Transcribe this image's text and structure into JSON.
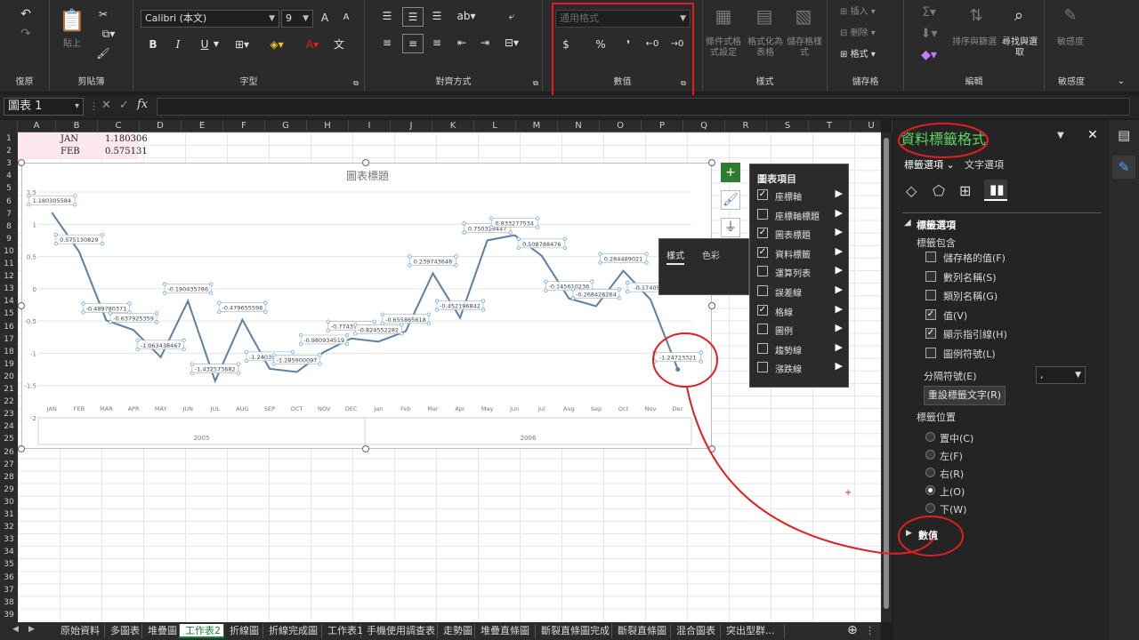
{
  "ribbon": {
    "clipboard": {
      "group_label": "剪貼簿",
      "paste": "貼上"
    },
    "undo": {
      "group_label": "復原"
    },
    "font": {
      "group_label": "字型",
      "name": "Calibri (本文)",
      "size": "9",
      "bold": "B",
      "italic": "I",
      "underline": "U",
      "grow": "A",
      "shrink": "A"
    },
    "alignment": {
      "group_label": "對齊方式"
    },
    "number": {
      "group_label": "數值",
      "format_placeholder": "通用格式",
      "currency": "$",
      "percent": "%",
      "comma": "❜",
      "inc_decimal": "←0",
      "dec_decimal": "→0"
    },
    "styles": {
      "group_label": "樣式",
      "cond_format": "條件式格式設定",
      "format_table": "格式化為表格",
      "cell_styles": "儲存格樣式"
    },
    "cells": {
      "group_label": "儲存格",
      "insert": "插入",
      "delete": "刪除",
      "format": "格式"
    },
    "editing": {
      "group_label": "編輯",
      "sort_filter": "排序與篩選",
      "find_select": "尋找與選取"
    },
    "sensitivity": {
      "group_label": "敏感度",
      "label": "敏感度"
    }
  },
  "formula_bar": {
    "name_box": "圖表 1",
    "fx": "fx"
  },
  "columns": [
    "A",
    "B",
    "C",
    "D",
    "E",
    "F",
    "G",
    "H",
    "I",
    "J",
    "K",
    "L",
    "M",
    "N",
    "O",
    "P",
    "Q",
    "R",
    "S",
    "T",
    "U"
  ],
  "rows": [
    "1",
    "2",
    "3",
    "4",
    "5",
    "6",
    "7",
    "8",
    "9",
    "10",
    "11",
    "12",
    "13",
    "14",
    "15",
    "16",
    "17",
    "18",
    "19",
    "20",
    "21",
    "22",
    "23",
    "24",
    "25",
    "26",
    "27",
    "28",
    "29",
    "30",
    "31",
    "32",
    "33",
    "34",
    "35",
    "36",
    "37",
    "38",
    "39"
  ],
  "cells": [
    {
      "label": "JAN",
      "value": "1.180306"
    },
    {
      "label": "FEB",
      "value": "0.575131"
    }
  ],
  "chart_data": {
    "type": "line",
    "title": "圖表標題",
    "categories": [
      "JAN",
      "FEB",
      "MAR",
      "APR",
      "MAY",
      "JUN",
      "JUL",
      "AUG",
      "SEP",
      "OCT",
      "NOV",
      "DEC",
      "Jan",
      "Feb",
      "Mar",
      "Apr",
      "May",
      "Jun",
      "Jul",
      "Aug",
      "Sep",
      "Oct",
      "Nov",
      "Dec"
    ],
    "year_groups": [
      {
        "label": "2005",
        "span": 12
      },
      {
        "label": "2006",
        "span": 12
      }
    ],
    "values": [
      1.18,
      0.575,
      -0.49,
      -0.64,
      -1.06,
      -0.19,
      -1.43,
      -0.48,
      -1.24,
      -1.29,
      -0.98,
      -0.77,
      -0.82,
      -0.66,
      0.24,
      -0.45,
      0.75,
      0.83,
      0.51,
      -0.15,
      -0.27,
      0.28,
      -0.17,
      -1.25
    ],
    "data_labels": [
      "1.180305584",
      "0.575130829",
      "-0.489780371",
      "-0.637925359",
      "-1.063438467",
      "-0.190435786",
      "-1.432573682",
      "-0.479655598",
      "-1.240352644",
      "-1.285900097",
      "-0.980934519",
      "-0.774379236",
      "-0.824552282",
      "-0.655865618",
      "0.239743648",
      "-0.452196842",
      "0.750329447",
      "0.833277534",
      "0.508788476",
      "-0.145610236",
      "-0.268426264",
      "0.284489021",
      "-0.1740592",
      "-1.24723321"
    ],
    "y_ticks": [
      "1.5",
      "1",
      "0.5",
      "0",
      "-0.5",
      "-1",
      "-1.5",
      "-2"
    ],
    "ylim": [
      -2,
      1.5
    ],
    "grid": true,
    "line_color": "#5b7fa6"
  },
  "chart_elements": {
    "title": "圖表項目",
    "items": [
      {
        "label": "座標軸",
        "checked": true
      },
      {
        "label": "座標軸標題",
        "checked": false
      },
      {
        "label": "圖表標題",
        "checked": true
      },
      {
        "label": "資料標籤",
        "checked": true
      },
      {
        "label": "運算列表",
        "checked": false
      },
      {
        "label": "誤差線",
        "checked": false
      },
      {
        "label": "格線",
        "checked": true
      },
      {
        "label": "圖例",
        "checked": false
      },
      {
        "label": "趨勢線",
        "checked": false
      },
      {
        "label": "漲跌線",
        "checked": false
      }
    ]
  },
  "style_popup": {
    "tab_style": "樣式",
    "tab_color": "色彩"
  },
  "pane": {
    "title": "資料標籤格式",
    "tab_label_options": "標籤選項",
    "tab_text_options": "文字選項",
    "section": "標籤選項",
    "contains": "標籤包含",
    "checkboxes": [
      {
        "label": "儲存格的值(F)",
        "checked": false
      },
      {
        "label": "數列名稱(S)",
        "checked": false
      },
      {
        "label": "類別名稱(G)",
        "checked": false
      },
      {
        "label": "值(V)",
        "checked": true
      },
      {
        "label": "顯示指引線(H)",
        "checked": true
      },
      {
        "label": "圖例符號(L)",
        "checked": false
      }
    ],
    "separator_label": "分隔符號(E)",
    "separator_value": ",",
    "reset_button": "重設標籤文字(R)",
    "position_label": "標籤位置",
    "positions": [
      {
        "label": "置中(C)",
        "selected": false
      },
      {
        "label": "左(F)",
        "selected": false
      },
      {
        "label": "右(R)",
        "selected": false
      },
      {
        "label": "上(O)",
        "selected": true
      },
      {
        "label": "下(W)",
        "selected": false
      }
    ],
    "number_section": "數值"
  },
  "tabs": [
    "原始資料",
    "多圖表",
    "堆疊圖",
    "工作表2",
    "折線圖",
    "折線完成圖",
    "工作表1",
    "手機使用調查表",
    "走勢圖",
    "堆疊直條圖",
    "斷裂直條圖完成",
    "斷裂直條圖",
    "混合圖表",
    "突出型群..."
  ],
  "active_tab": 3,
  "colors": {
    "accent_green": "#1a7f37",
    "annotation_red": "#e02020",
    "pane_bg": "#242424"
  }
}
